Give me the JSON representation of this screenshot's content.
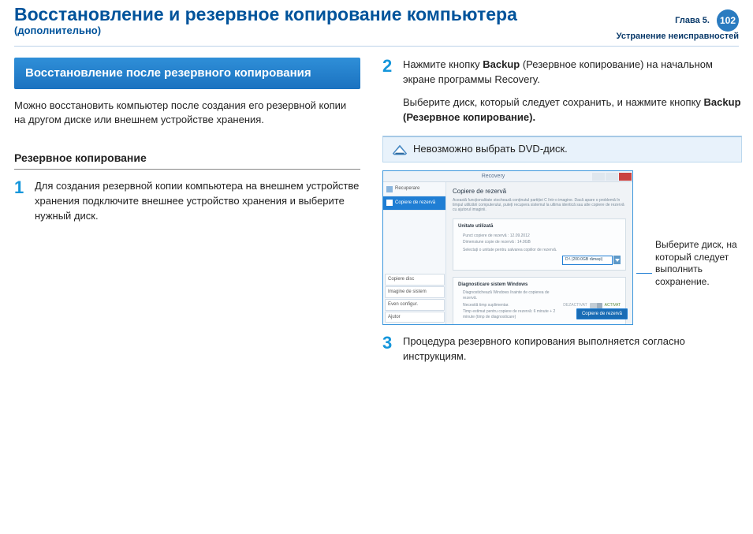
{
  "header": {
    "title": "Восстановление и резервное копирование компьютера",
    "subtitle": "(дополнительно)",
    "chapter_line1": "Глава 5.",
    "chapter_line2": "Устранение неисправностей",
    "page_number": "102"
  },
  "left": {
    "section_band": "Восстановление после резервного копирования",
    "intro": "Можно восстановить компьютер после создания его резервной копии на другом диске или внешнем устройстве хранения.",
    "subhead": "Резервное копирование",
    "step1_num": "1",
    "step1_text": "Для создания резервной копии компьютера на внешнем устройстве хранения подключите внешнее устройство хранения и выберите нужный диск."
  },
  "right": {
    "step2_num": "2",
    "step2_pre": "Нажмите кнопку ",
    "step2_bold1": "Backup",
    "step2_mid": " (Резервное копирование) на начальном экране программы Recovery.",
    "step2b_pre": "Выберите диск, который следует сохранить, и нажмите кнопку ",
    "step2b_bold": "Backup (Резервное копирование).",
    "note": "Невозможно выбрать DVD-диск.",
    "callout": "Выберите диск, на который следует выполнить сохранение.",
    "step3_num": "3",
    "step3_text": "Процедура резервного копирования выполняется согласно инструкциям."
  },
  "recovery_window": {
    "title": "Recovery",
    "sidebar": {
      "item1": "Recuperare",
      "item2": "Copiere de rezervă",
      "bottom1": "Copiere disc",
      "bottom2": "Imagine de sistem",
      "bottom3": "Even configur.",
      "bottom4": "Ajutor"
    },
    "main_title": "Copiere de rezervă",
    "main_desc": "Această funcționalitate stochează conținutul partiției C într-o imagine. Dacă apare o problemă în timpul utilizării computerului, puteți recupera sistemul la ultima identică sau alte copiere de rezervă cu ajutorul imaginii.",
    "panel1_title": "Unitate utilizată",
    "panel1_line1": "Punct copiere de rezervă : 12.09.2012",
    "panel1_line2": "Dimensiune copie de rezervă : 14.0GB",
    "panel1_line3": "Selectați o unitate pentru salvarea copiilor de rezervă.",
    "disk_value": "D:\\ (200.0GB rămași)",
    "panel2_title": "Diagnosticare sistem Windows",
    "panel2_line1": "Diagnostichează Windows înainte de copierea de rezervă.",
    "panel2_line2": "Necesită timp suplimentar.",
    "panel2_line3": "Timp estimat pentru copiere de rezervă: 6 minute + 2 minute (timp de diagnosticare)",
    "toggle_off": "DEZACTIVAT",
    "toggle_on": "ACTIVAT",
    "button": "Copiere de rezervă"
  }
}
